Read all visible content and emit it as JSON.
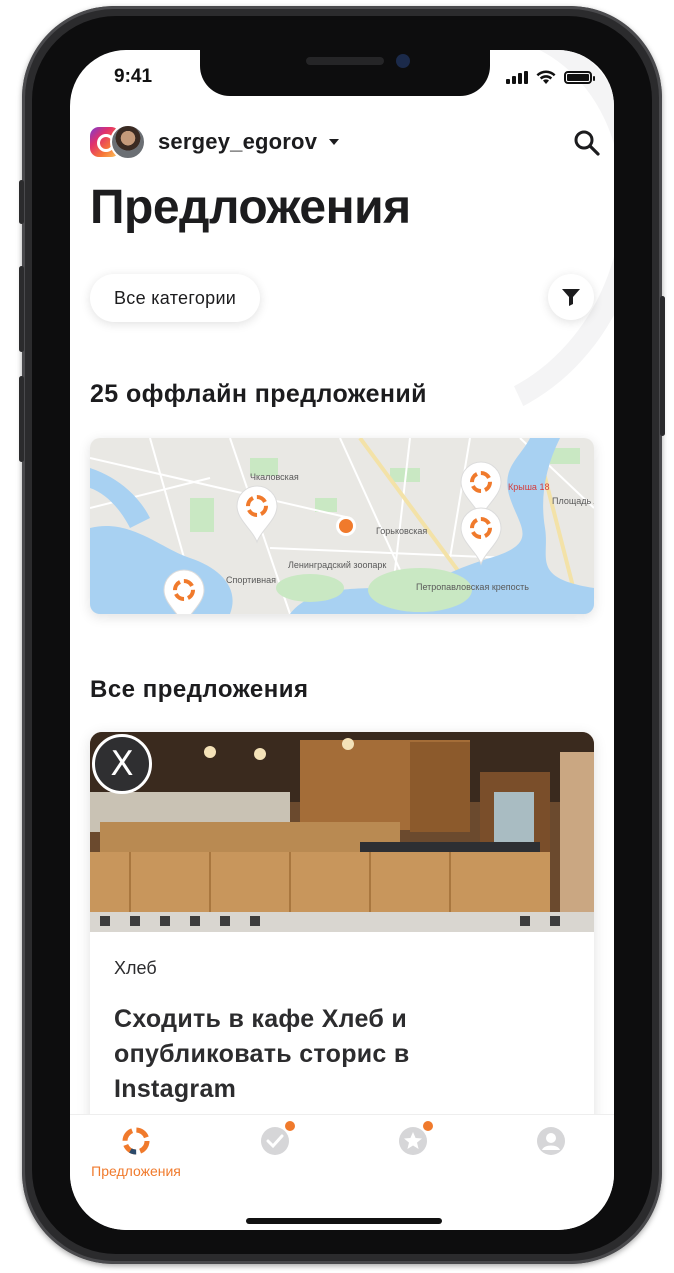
{
  "status_bar": {
    "time": "9:41"
  },
  "header": {
    "username": "sergey_egorov",
    "title": "Предложения"
  },
  "filters": {
    "category_label": "Все категории"
  },
  "offline": {
    "heading": "25 оффлайн предложений",
    "map_labels": [
      "Чкаловская",
      "Горьковская",
      "Ленинградский зоопарк",
      "Петропавловская крепость",
      "Спортивная",
      "Площадь Лен",
      "Крыша 18"
    ]
  },
  "all_offers": {
    "heading": "Все предложения",
    "cards": [
      {
        "category": "Хлеб",
        "title": "Сходить в кафе Хлеб и опубликовать сторис в Instagram",
        "brand_mark": "X"
      }
    ]
  },
  "tabbar": {
    "items": [
      {
        "label": "Предложения",
        "icon": "offers-ring-icon",
        "active": true
      },
      {
        "label": "",
        "icon": "check-circle-icon",
        "badge": true
      },
      {
        "label": "",
        "icon": "star-circle-icon",
        "badge": true
      },
      {
        "label": "",
        "icon": "profile-icon"
      }
    ]
  },
  "colors": {
    "accent": "#f07a2c",
    "text": "#1c1c1e"
  }
}
